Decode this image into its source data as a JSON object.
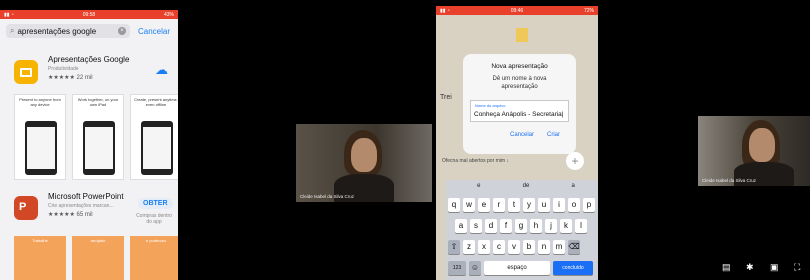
{
  "left_phone": {
    "status_time": "09:58",
    "status_battery": "43%",
    "search_query": "apresentações google",
    "cancel_label": "Cancelar",
    "app1": {
      "title": "Apresentações Google",
      "subtitle": "Produtividade",
      "rating": "★★★★★ 22 mil",
      "screens": [
        "Present to anyone from any device",
        "Work together, on your own iPad",
        "Create, present anytime, even offline"
      ]
    },
    "app2": {
      "title": "Microsoft PowerPoint",
      "subtitle": "Crie apresentações marcan...",
      "rating": "★★★★★ 65 mil",
      "get_label": "OBTER",
      "purchase_note": "Compras dentro do app",
      "screens": [
        "Trabalhe",
        "arrojado",
        "e poderoso"
      ]
    }
  },
  "tile1": {
    "name": "Cleide Isabel da Silva Cruz"
  },
  "right_phone": {
    "status_time": "09:46",
    "status_battery": "72%",
    "bg_partial_label": "Trei",
    "bg_bottom_text": "Ofecna mal abertos por mim ↓",
    "dialog": {
      "title": "Nova apresentação",
      "message_line1": "Dê um nome à nova",
      "message_line2": "apresentação",
      "field_label": "Nome do arquivo",
      "field_value": "Conheça Anápolis - Secretaria|",
      "cancel": "Cancelar",
      "create": "Criar"
    },
    "suggestions": [
      "e",
      "de",
      "a"
    ],
    "keys_row1": [
      "q",
      "w",
      "e",
      "r",
      "t",
      "y",
      "u",
      "i",
      "o",
      "p"
    ],
    "keys_row2": [
      "a",
      "s",
      "d",
      "f",
      "g",
      "h",
      "j",
      "k",
      "l"
    ],
    "keys_row3": [
      "z",
      "x",
      "c",
      "v",
      "b",
      "n",
      "m"
    ],
    "key_123": "123",
    "key_space": "espaço",
    "key_return": "concluído"
  },
  "tile2": {
    "name": "Cleide Isabel da Silva Cruz"
  },
  "player_controls": [
    "subtitles-icon",
    "settings-icon",
    "miniplayer-icon",
    "fullscreen-icon"
  ],
  "colors": {
    "ios_red": "#e9402b",
    "ios_blue": "#1a7ff5"
  }
}
